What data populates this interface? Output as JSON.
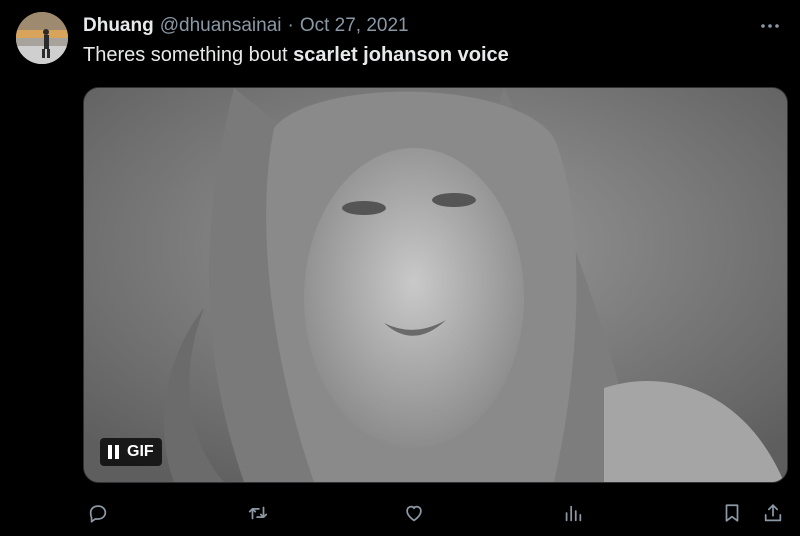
{
  "tweet": {
    "author_name": "Dhuang",
    "author_handle": "@dhuansainai",
    "separator": "·",
    "date": "Oct 27, 2021",
    "text_plain": "Theres something bout ",
    "text_bold": "scarlet johanson voice",
    "media": {
      "badge_label": "GIF"
    }
  },
  "icons": {
    "more": "more-dots-icon",
    "pause": "pause-icon",
    "reply": "reply-icon",
    "retweet": "retweet-icon",
    "like": "heart-icon",
    "views": "views-chart-icon",
    "bookmark": "bookmark-icon",
    "share": "share-icon"
  },
  "colors": {
    "background": "#000000",
    "text_primary": "#e7e9ea",
    "text_secondary": "#8b98a5",
    "border": "#2f3336"
  }
}
